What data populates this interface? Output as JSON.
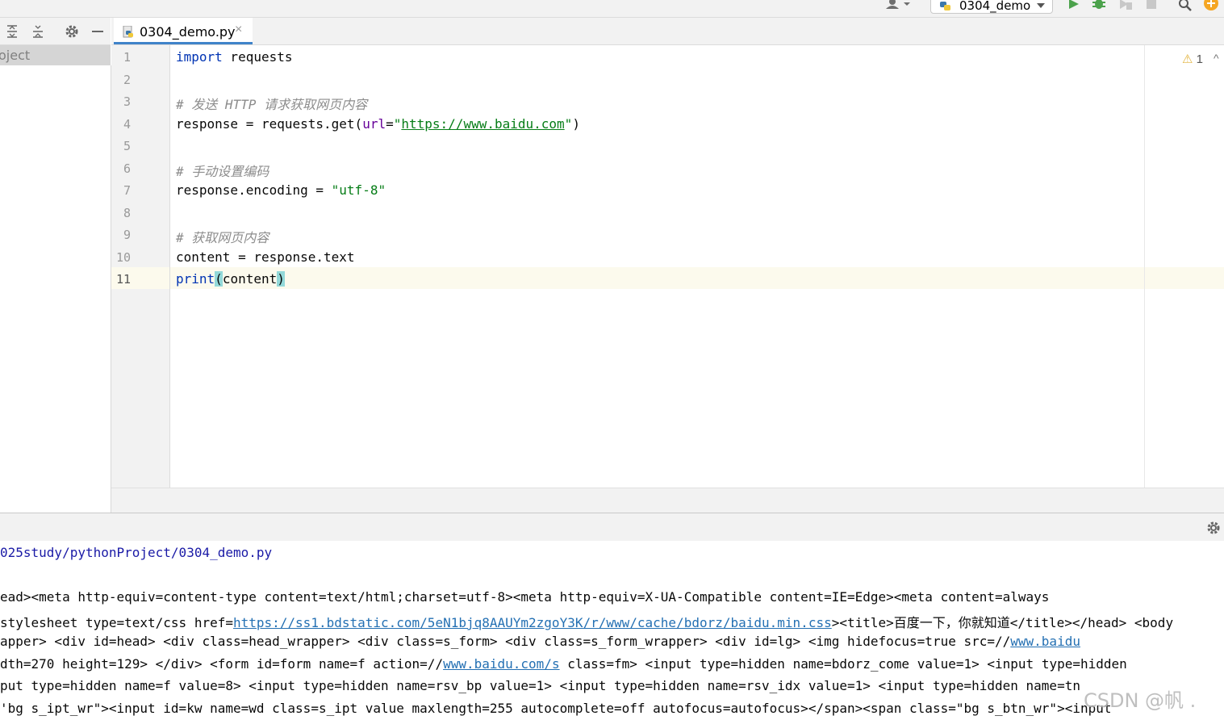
{
  "toolbar": {
    "run_config_name": "0304_demo",
    "icons": [
      "user-icon",
      "python-icon",
      "chevron-down-icon",
      "run-icon",
      "debug-icon",
      "coverage-icon",
      "stop-icon",
      "search-icon",
      "update-icon"
    ]
  },
  "project_panel": {
    "label": "oject",
    "icons": [
      "expand-all-icon",
      "collapse-all-icon",
      "gear-icon",
      "minimize-icon"
    ]
  },
  "tab": {
    "file_name": "0304_demo.py",
    "close_glyph": "×"
  },
  "editor": {
    "line_numbers": [
      "1",
      "2",
      "3",
      "4",
      "5",
      "6",
      "7",
      "8",
      "9",
      "10",
      "11"
    ],
    "current_line": 11,
    "lines": [
      {
        "kw": "import",
        "rest": " requests"
      },
      {},
      {
        "comment": "# 发送 HTTP 请求获取网页内容"
      },
      {
        "a": "response = requests.get(",
        "param": "url",
        "eq": "=",
        "q1": "\"",
        "url": "https://www.baidu.com",
        "q2": "\"",
        "end": ")"
      },
      {},
      {
        "comment": "# 手动设置编码"
      },
      {
        "a": "response.encoding = ",
        "str": "\"utf-8\""
      },
      {},
      {
        "comment": "# 获取网页内容"
      },
      {
        "a": "content = response.text"
      },
      {
        "kw": "print",
        "b1": "(",
        "mid": "content",
        "b2": ")"
      }
    ],
    "inspection": {
      "warning_count": "1",
      "warn_glyph": "⚠",
      "up_glyph": "^"
    }
  },
  "console": {
    "path_line": "025study/pythonProject/0304_demo.py",
    "lines": [
      {
        "text": "ead><meta http-equiv=content-type content=text/html;charset=utf-8><meta http-equiv=X-UA-Compatible content=IE=Edge><meta content=always"
      },
      {
        "pre": "stylesheet type=text/css href=",
        "link": "https://ss1.bdstatic.com/5eN1bjq8AAUYm2zgoY3K/r/www/cache/bdorz/baidu.min.css",
        "post": "><title>百度一下，你就知道</title></head> <body"
      },
      {
        "pre": "apper> <div id=head> <div class=head_wrapper> <div class=s_form> <div class=s_form_wrapper> <div id=lg> <img hidefocus=true src=//",
        "link": "www.baidu",
        "post": ""
      },
      {
        "pre": "dth=270 height=129> </div> <form id=form name=f action=//",
        "link": "www.baidu.com/s",
        "post": " class=fm> <input type=hidden name=bdorz_come value=1> <input type=hidden"
      },
      {
        "text": "put type=hidden name=f value=8> <input type=hidden name=rsv_bp value=1> <input type=hidden name=rsv_idx value=1> <input type=hidden name=tn"
      },
      {
        "text": "'bg s_ipt_wr\"><input id=kw name=wd class=s_ipt value maxlength=255 autocomplete=off autofocus=autofocus></span><span class=\"bg s_btn_wr\"><input"
      }
    ]
  },
  "watermark": "CSDN @帆 ."
}
